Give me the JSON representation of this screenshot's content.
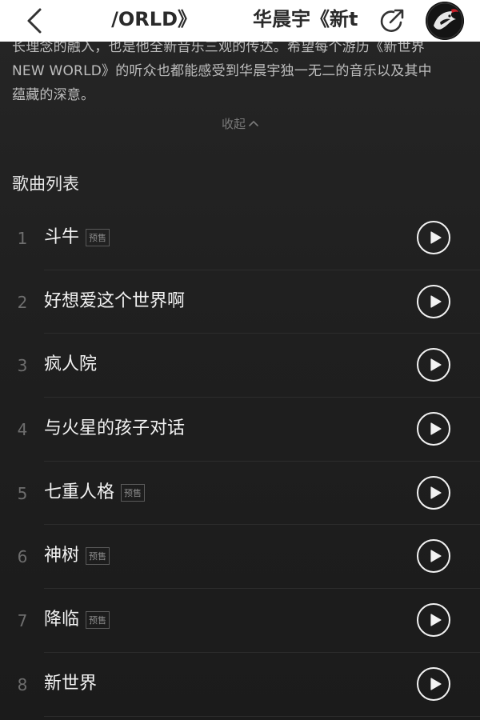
{
  "navbar": {
    "title_scroll_left": "/ORLD》",
    "title_scroll_right": "华晨宇《新t",
    "icons": [
      "back-chevron-icon",
      "share-icon",
      "avatar"
    ]
  },
  "description": {
    "lines": [
      "长理念的融入，也是他全新音乐三观的传达。希望每个游历《新世界",
      "NEW WORLD》的听众也都能感受到华晨宇独一无二的音乐以及其中",
      "蕴藏的深意。"
    ],
    "collapse_label": "收起"
  },
  "song_list": {
    "title": "歌曲列表",
    "presale_label": "预售",
    "songs": [
      {
        "num": "1",
        "title": "斗牛",
        "presale": true
      },
      {
        "num": "2",
        "title": "好想爱这个世界啊",
        "presale": false
      },
      {
        "num": "3",
        "title": "疯人院",
        "presale": false
      },
      {
        "num": "4",
        "title": "与火星的孩子对话",
        "presale": false
      },
      {
        "num": "5",
        "title": "七重人格",
        "presale": true
      },
      {
        "num": "6",
        "title": "神树",
        "presale": true
      },
      {
        "num": "7",
        "title": "降临",
        "presale": true
      },
      {
        "num": "8",
        "title": "新世界",
        "presale": false
      }
    ]
  },
  "colors": {
    "background": "#1d1d1d",
    "navbar": "#ffffff",
    "text_primary": "#f2f2f2",
    "text_secondary": "#bdbdbd",
    "text_muted": "#6e6e6e"
  }
}
